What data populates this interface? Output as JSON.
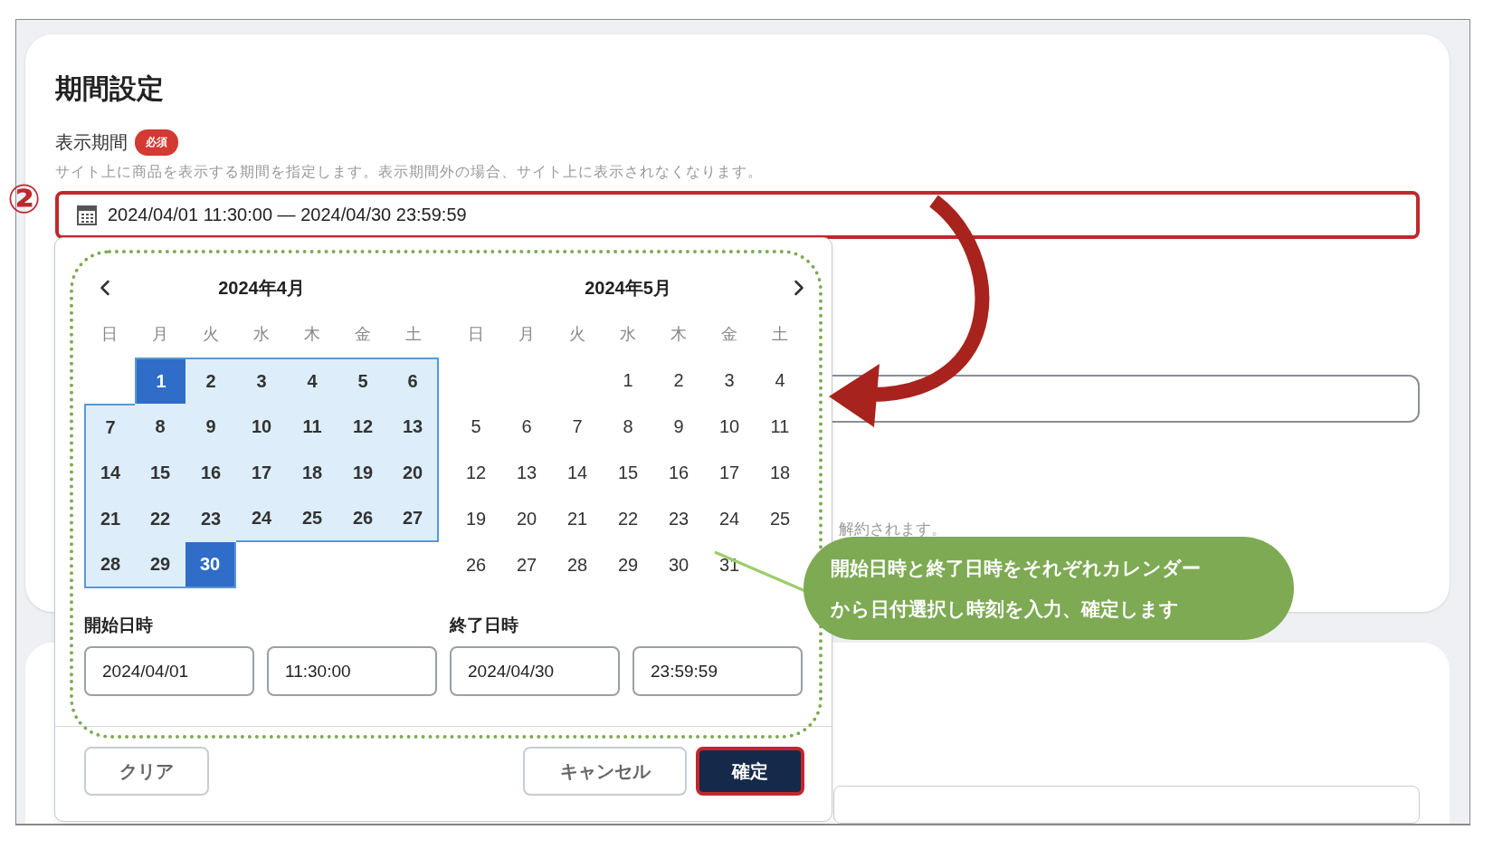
{
  "section": {
    "title": "期間設定",
    "field_label": "表示期間",
    "required_badge": "必須",
    "description": "サイト上に商品を表示する期間を指定します。表示期間外の場合、サイト上に表示されなくなります。",
    "range_value": "2024/04/01 11:30:00 — 2024/04/30 23:59:59",
    "range_highlighted": true
  },
  "annotation_marker": "②",
  "obscured_text": "解約されます。",
  "calendar": {
    "months": [
      {
        "title": "2024年4月",
        "weekdays": [
          "日",
          "月",
          "火",
          "水",
          "木",
          "金",
          "土"
        ],
        "weeks": [
          {
            "kind": "opening",
            "days": [
              {
                "label": "1",
                "selected": true,
                "in_range": true
              },
              {
                "label": "2",
                "selected": false,
                "in_range": true
              },
              {
                "label": "3",
                "selected": false,
                "in_range": true
              },
              {
                "label": "4",
                "selected": false,
                "in_range": true
              },
              {
                "label": "5",
                "selected": false,
                "in_range": true
              },
              {
                "label": "6",
                "selected": false,
                "in_range": true
              }
            ]
          },
          {
            "kind": "full",
            "days": [
              {
                "label": "7",
                "selected": false,
                "in_range": true
              },
              {
                "label": "8",
                "selected": false,
                "in_range": true
              },
              {
                "label": "9",
                "selected": false,
                "in_range": true
              },
              {
                "label": "10",
                "selected": false,
                "in_range": true
              },
              {
                "label": "11",
                "selected": false,
                "in_range": true
              },
              {
                "label": "12",
                "selected": false,
                "in_range": true
              },
              {
                "label": "13",
                "selected": false,
                "in_range": true
              }
            ]
          },
          {
            "kind": "full",
            "days": [
              {
                "label": "14",
                "selected": false,
                "in_range": true
              },
              {
                "label": "15",
                "selected": false,
                "in_range": true
              },
              {
                "label": "16",
                "selected": false,
                "in_range": true
              },
              {
                "label": "17",
                "selected": false,
                "in_range": true
              },
              {
                "label": "18",
                "selected": false,
                "in_range": true
              },
              {
                "label": "19",
                "selected": false,
                "in_range": true
              },
              {
                "label": "20",
                "selected": false,
                "in_range": true
              }
            ]
          },
          {
            "kind": "full",
            "days": [
              {
                "label": "21",
                "selected": false,
                "in_range": true
              },
              {
                "label": "22",
                "selected": false,
                "in_range": true
              },
              {
                "label": "23",
                "selected": false,
                "in_range": true
              },
              {
                "label": "24",
                "selected": false,
                "in_range": true
              },
              {
                "label": "25",
                "selected": false,
                "in_range": true
              },
              {
                "label": "26",
                "selected": false,
                "in_range": true
              },
              {
                "label": "27",
                "selected": false,
                "in_range": true
              }
            ]
          },
          {
            "kind": "closing",
            "days": [
              {
                "label": "28",
                "selected": false,
                "in_range": true
              },
              {
                "label": "29",
                "selected": false,
                "in_range": true
              },
              {
                "label": "30",
                "selected": true,
                "in_range": true
              }
            ]
          }
        ]
      },
      {
        "title": "2024年5月",
        "weekdays": [
          "日",
          "月",
          "火",
          "水",
          "木",
          "金",
          "土"
        ],
        "weeks": [
          {
            "kind": "opening",
            "days": [
              {
                "label": "1",
                "selected": false,
                "in_range": false
              },
              {
                "label": "2",
                "selected": false,
                "in_range": false
              },
              {
                "label": "3",
                "selected": false,
                "in_range": false
              },
              {
                "label": "4",
                "selected": false,
                "in_range": false
              }
            ]
          },
          {
            "kind": "full",
            "days": [
              {
                "label": "5",
                "selected": false,
                "in_range": false
              },
              {
                "label": "6",
                "selected": false,
                "in_range": false
              },
              {
                "label": "7",
                "selected": false,
                "in_range": false
              },
              {
                "label": "8",
                "selected": false,
                "in_range": false
              },
              {
                "label": "9",
                "selected": false,
                "in_range": false
              },
              {
                "label": "10",
                "selected": false,
                "in_range": false
              },
              {
                "label": "11",
                "selected": false,
                "in_range": false
              }
            ]
          },
          {
            "kind": "full",
            "days": [
              {
                "label": "12",
                "selected": false,
                "in_range": false
              },
              {
                "label": "13",
                "selected": false,
                "in_range": false
              },
              {
                "label": "14",
                "selected": false,
                "in_range": false
              },
              {
                "label": "15",
                "selected": false,
                "in_range": false
              },
              {
                "label": "16",
                "selected": false,
                "in_range": false
              },
              {
                "label": "17",
                "selected": false,
                "in_range": false
              },
              {
                "label": "18",
                "selected": false,
                "in_range": false
              }
            ]
          },
          {
            "kind": "full",
            "days": [
              {
                "label": "19",
                "selected": false,
                "in_range": false
              },
              {
                "label": "20",
                "selected": false,
                "in_range": false
              },
              {
                "label": "21",
                "selected": false,
                "in_range": false
              },
              {
                "label": "22",
                "selected": false,
                "in_range": false
              },
              {
                "label": "23",
                "selected": false,
                "in_range": false
              },
              {
                "label": "24",
                "selected": false,
                "in_range": false
              },
              {
                "label": "25",
                "selected": false,
                "in_range": false
              }
            ]
          },
          {
            "kind": "closing",
            "days": [
              {
                "label": "26",
                "selected": false,
                "in_range": false
              },
              {
                "label": "27",
                "selected": false,
                "in_range": false
              },
              {
                "label": "28",
                "selected": false,
                "in_range": false
              },
              {
                "label": "29",
                "selected": false,
                "in_range": false
              },
              {
                "label": "30",
                "selected": false,
                "in_range": false
              },
              {
                "label": "31",
                "selected": false,
                "in_range": false
              }
            ]
          }
        ]
      }
    ],
    "start": {
      "label": "開始日時",
      "date": "2024/04/01",
      "time": "11:30:00"
    },
    "end": {
      "label": "終了日時",
      "date": "2024/04/30",
      "time": "23:59:59"
    },
    "buttons": [
      {
        "kind": "clear",
        "label": "クリア",
        "highlighted": false
      },
      {
        "kind": "cancel",
        "label": "キャンセル",
        "highlighted": false
      },
      {
        "kind": "confirm",
        "label": "確定",
        "highlighted": true
      }
    ]
  },
  "callout": {
    "lines": [
      "開始日時と終了日時をそれぞれカレンダー",
      "から日付選択し時刻を入力、確定します"
    ]
  }
}
